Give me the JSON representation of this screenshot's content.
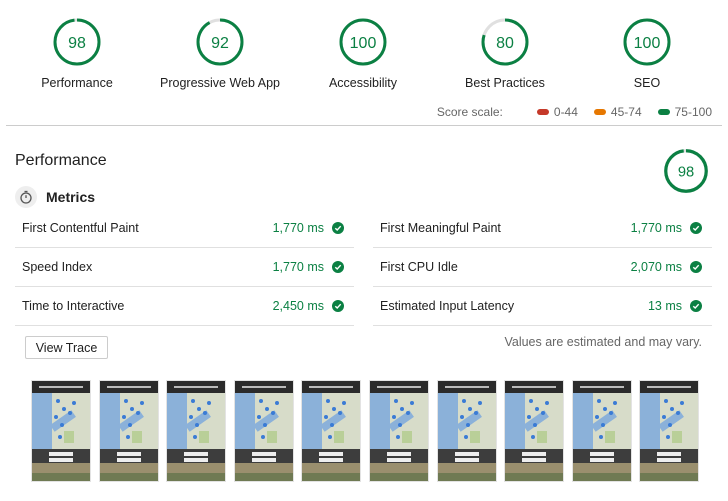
{
  "categories": [
    {
      "label": "Performance",
      "score": "98",
      "value": 98
    },
    {
      "label": "Progressive Web App",
      "score": "92",
      "value": 92
    },
    {
      "label": "Accessibility",
      "score": "100",
      "value": 100
    },
    {
      "label": "Best Practices",
      "score": "80",
      "value": 80
    },
    {
      "label": "SEO",
      "score": "100",
      "value": 100
    }
  ],
  "score_scale": {
    "label": "Score scale:",
    "ranges": [
      {
        "label": "0-44",
        "color": "#c53929"
      },
      {
        "label": "45-74",
        "color": "#e67700"
      },
      {
        "label": "75-100",
        "color": "#0b8043"
      }
    ]
  },
  "performance": {
    "title": "Performance",
    "score": "98",
    "value": 98,
    "metrics_title": "Metrics",
    "metrics": [
      {
        "name": "First Contentful Paint",
        "value": "1,770 ms"
      },
      {
        "name": "First Meaningful Paint",
        "value": "1,770 ms"
      },
      {
        "name": "Speed Index",
        "value": "1,770 ms"
      },
      {
        "name": "First CPU Idle",
        "value": "2,070 ms"
      },
      {
        "name": "Time to Interactive",
        "value": "2,450 ms"
      },
      {
        "name": "Estimated Input Latency",
        "value": "13 ms"
      }
    ],
    "view_trace_label": "View Trace",
    "note": "Values are estimated and may vary."
  },
  "colors": {
    "pass": "#0b8043",
    "track": "#e0e0e0"
  },
  "filmstrip": {
    "frame_count": 10
  }
}
